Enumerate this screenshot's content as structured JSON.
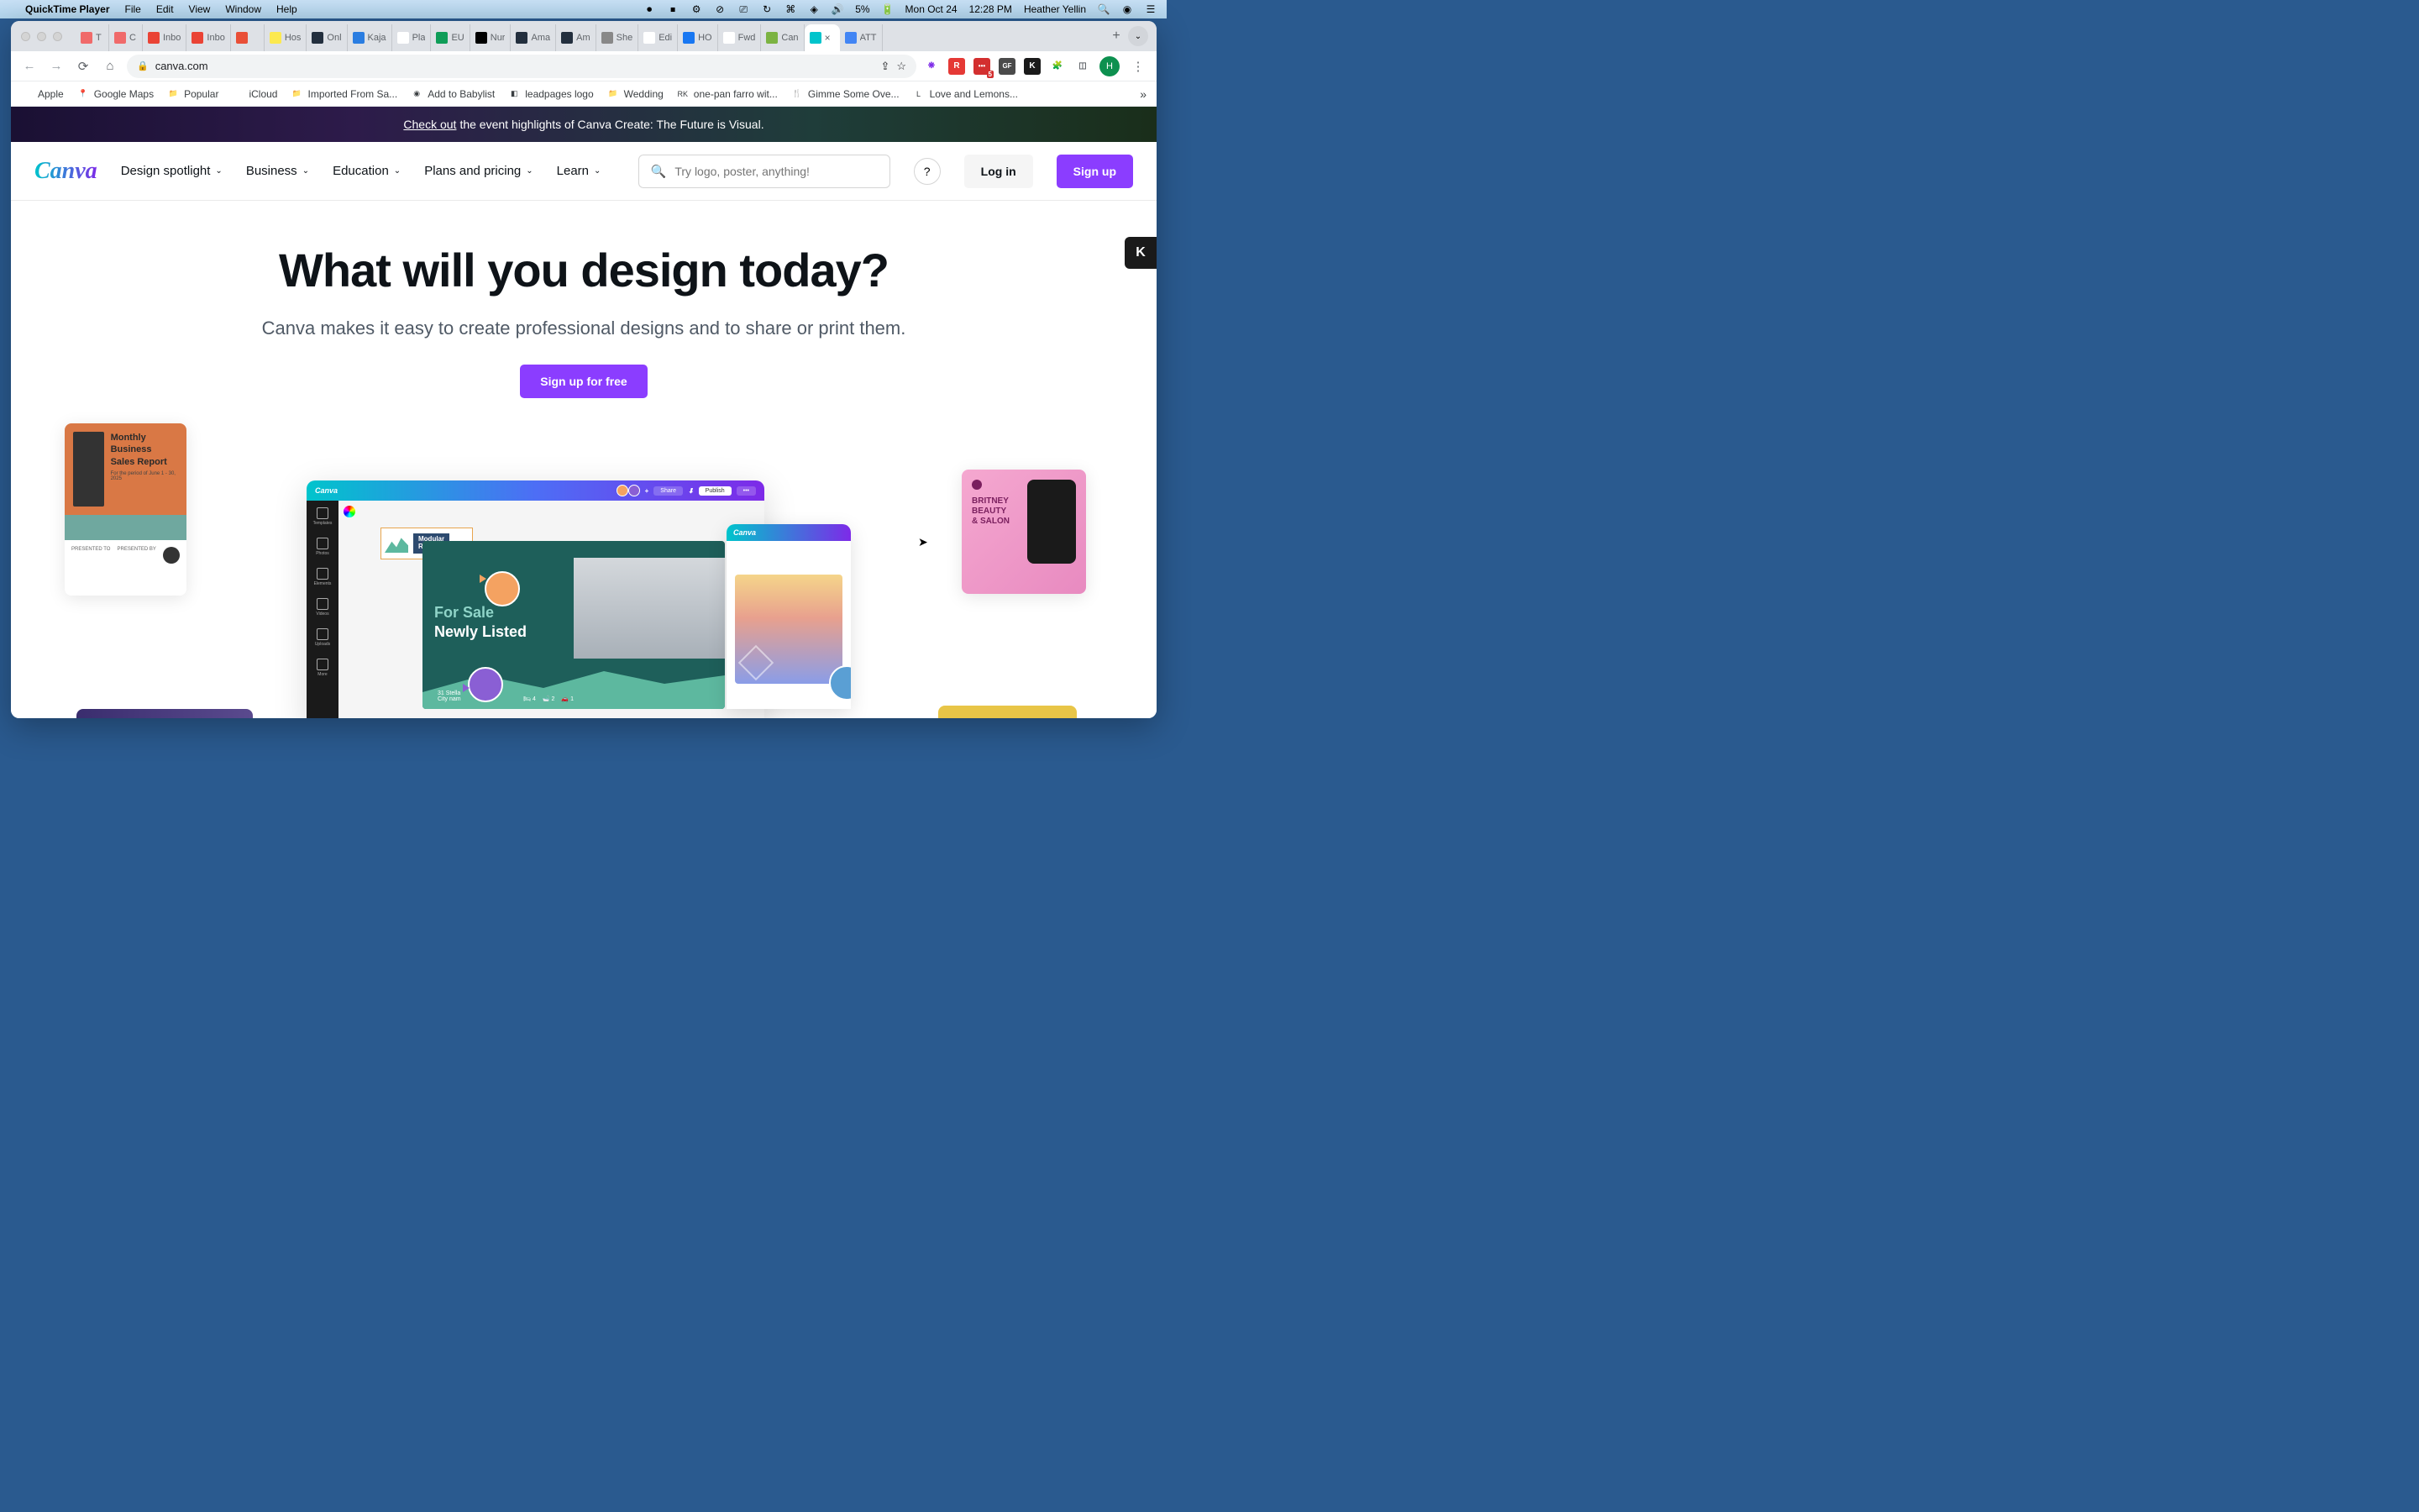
{
  "menubar": {
    "app_name": "QuickTime Player",
    "items": [
      "File",
      "Edit",
      "View",
      "Window",
      "Help"
    ],
    "battery": "5%",
    "date": "Mon Oct 24",
    "time": "12:28 PM",
    "user": "Heather Yellin"
  },
  "browser": {
    "url": "canva.com",
    "tabs": [
      {
        "label": "T",
        "favicon_bg": "#f06a6a"
      },
      {
        "label": "C",
        "favicon_bg": "#f06a6a"
      },
      {
        "label": "Inbo",
        "favicon_bg": "#ea4335"
      },
      {
        "label": "Inbo",
        "favicon_bg": "#ea4335"
      },
      {
        "label": "",
        "favicon_bg": "#e94f37"
      },
      {
        "label": "Hos",
        "favicon_bg": "#fce94f"
      },
      {
        "label": "Onl",
        "favicon_bg": "#232f3e"
      },
      {
        "label": "Kaja",
        "favicon_bg": "#2a7de1"
      },
      {
        "label": "Pla",
        "favicon_bg": "#fff"
      },
      {
        "label": "EU",
        "favicon_bg": "#0f9d58"
      },
      {
        "label": "Nur",
        "favicon_bg": "#000"
      },
      {
        "label": "Ama",
        "favicon_bg": "#232f3e"
      },
      {
        "label": "Am",
        "favicon_bg": "#232f3e"
      },
      {
        "label": "She",
        "favicon_bg": "#888"
      },
      {
        "label": "Edi",
        "favicon_bg": "#fff"
      },
      {
        "label": "HO",
        "favicon_bg": "#1877f2"
      },
      {
        "label": "Fwd",
        "favicon_bg": "#fff"
      },
      {
        "label": "Can",
        "favicon_bg": "#7cb342"
      },
      {
        "label": "",
        "favicon_bg": "#00c4cc",
        "active": true
      },
      {
        "label": "ATT",
        "favicon_bg": "#4285f4"
      }
    ],
    "profile_initial": "H",
    "bookmarks": [
      {
        "label": "Apple",
        "icon": ""
      },
      {
        "label": "Google Maps",
        "icon": "📍"
      },
      {
        "label": "Popular",
        "icon": "📁"
      },
      {
        "label": "iCloud",
        "icon": ""
      },
      {
        "label": "Imported From Sa...",
        "icon": "📁"
      },
      {
        "label": "Add to Babylist",
        "icon": "◉"
      },
      {
        "label": "leadpages logo",
        "icon": "◧"
      },
      {
        "label": "Wedding",
        "icon": "📁"
      },
      {
        "label": "one-pan farro wit...",
        "icon": "RK"
      },
      {
        "label": "Gimme Some Ove...",
        "icon": "🍴"
      },
      {
        "label": "Love and Lemons...",
        "icon": "L"
      }
    ]
  },
  "page": {
    "banner_link": "Check out",
    "banner_text": "the event highlights of Canva Create: The Future is Visual.",
    "logo": "Canva",
    "nav": [
      "Design spotlight",
      "Business",
      "Education",
      "Plans and pricing",
      "Learn"
    ],
    "search_placeholder": "Try logo, poster, anything!",
    "login": "Log in",
    "signup": "Sign up",
    "hero_title": "What will you design today?",
    "hero_subtitle": "Canva makes it easy to create professional designs and to share or print them.",
    "hero_cta": "Sign up for free",
    "float_tab": "K"
  },
  "templates": {
    "left": {
      "title_1": "Monthly",
      "title_2": "Business",
      "title_3": "Sales Report",
      "subtitle": "For the period of June 1 - 30, 2025",
      "presented_to": "PRESENTED TO",
      "presented_by": "PRESENTED BY"
    },
    "right": {
      "line1": "BRITNEY",
      "line2": "BEAUTY",
      "line3": "& SALON"
    },
    "editor": {
      "logo": "Canva",
      "share": "Share",
      "publish": "Publish",
      "sidebar_items": [
        "Templates",
        "Photos",
        "Elements",
        "Videos",
        "Uploads",
        "More"
      ],
      "brand_name_1": "Modular",
      "brand_name_2": "Realty.",
      "forsale_1": "For Sale",
      "forsale_2": "Newly Listed",
      "address_1": "31 Stella",
      "address_2": "City nam",
      "stat_beds": "4",
      "stat_baths": "2",
      "stat_cars": "1"
    },
    "mini_logo": "Canva"
  }
}
